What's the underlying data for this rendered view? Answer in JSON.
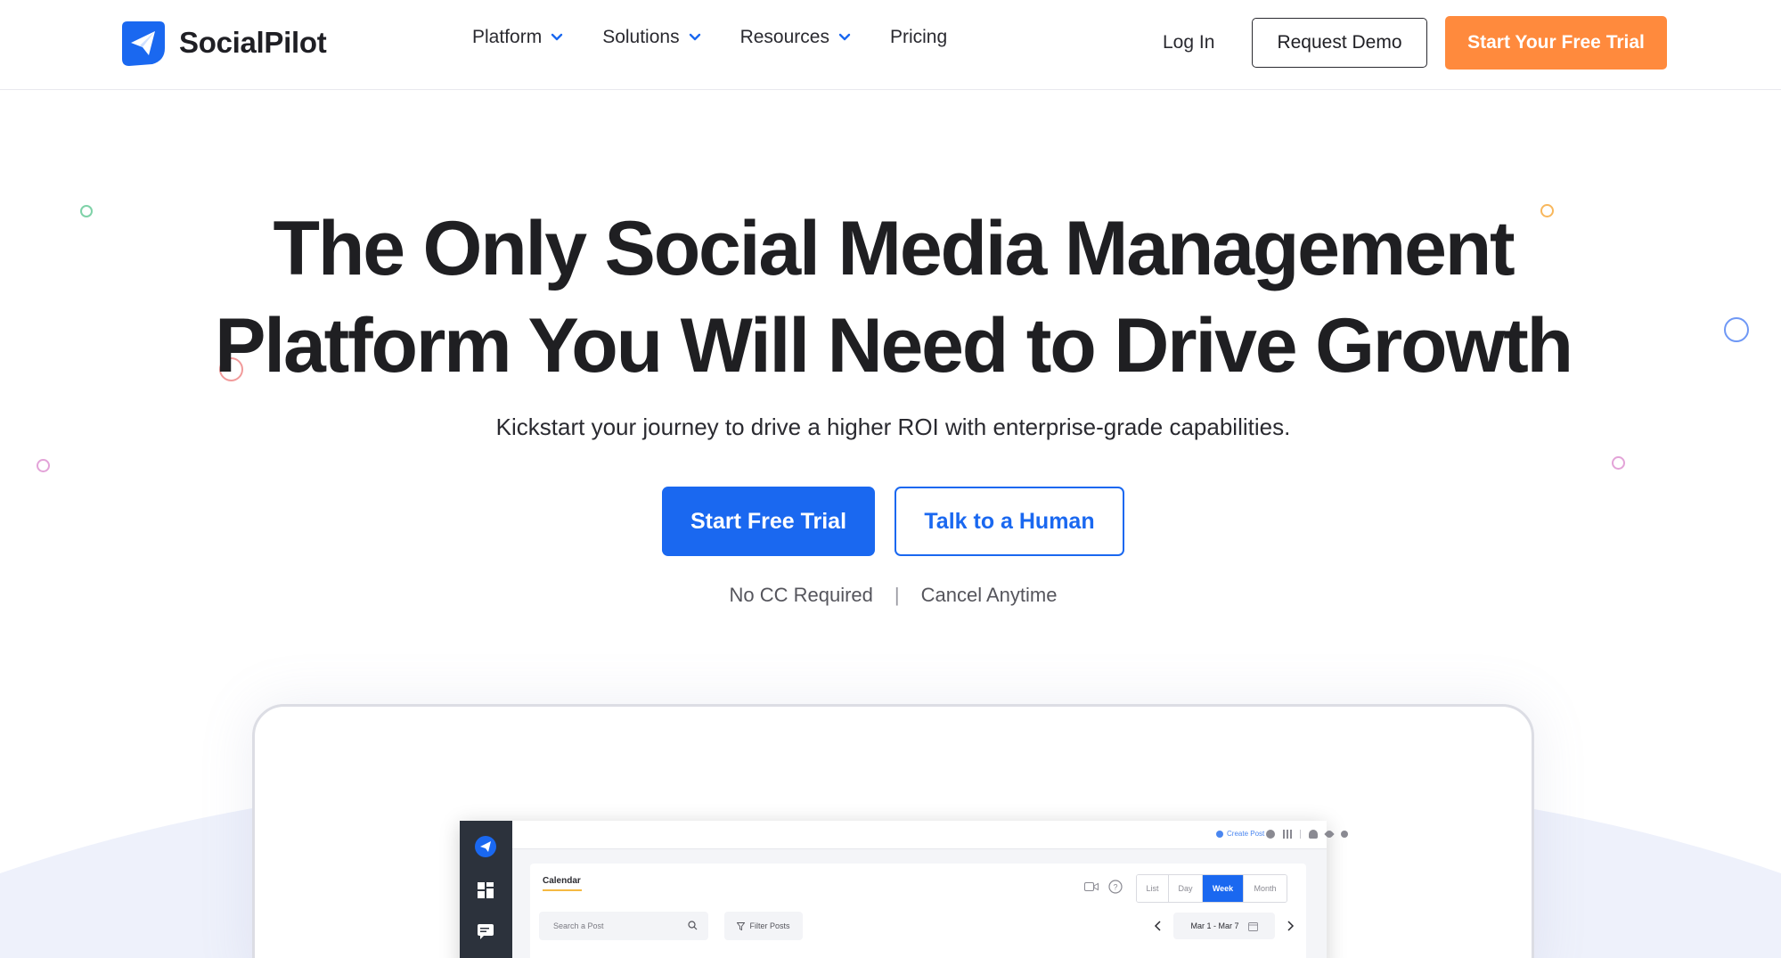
{
  "brand": {
    "name": "SocialPilot",
    "primary_color": "#1a68f0",
    "accent_color": "#ff8a3d"
  },
  "nav": {
    "items": [
      {
        "label": "Platform",
        "has_dropdown": true
      },
      {
        "label": "Solutions",
        "has_dropdown": true
      },
      {
        "label": "Resources",
        "has_dropdown": true
      },
      {
        "label": "Pricing",
        "has_dropdown": false
      }
    ],
    "login": "Log In",
    "request_demo": "Request Demo",
    "start_trial": "Start Your Free Trial"
  },
  "hero": {
    "headline_line1": "The Only Social Media Management",
    "headline_line2": "Platform You Will Need to Drive Growth",
    "subline": "Kickstart your journey to drive a higher ROI with enterprise-grade capabilities.",
    "primary_cta": "Start Free Trial",
    "secondary_cta": "Talk to a Human",
    "note_1": "No CC Required",
    "note_separator": "|",
    "note_2": "Cancel Anytime"
  },
  "app_preview": {
    "create_post": "Create Post",
    "calendar_title": "Calendar",
    "search_placeholder": "Search a Post",
    "filter_label": "Filter Posts",
    "views": [
      "List",
      "Day",
      "Week",
      "Month"
    ],
    "active_view": "Week",
    "date_range": "Mar 1 - Mar 7"
  }
}
